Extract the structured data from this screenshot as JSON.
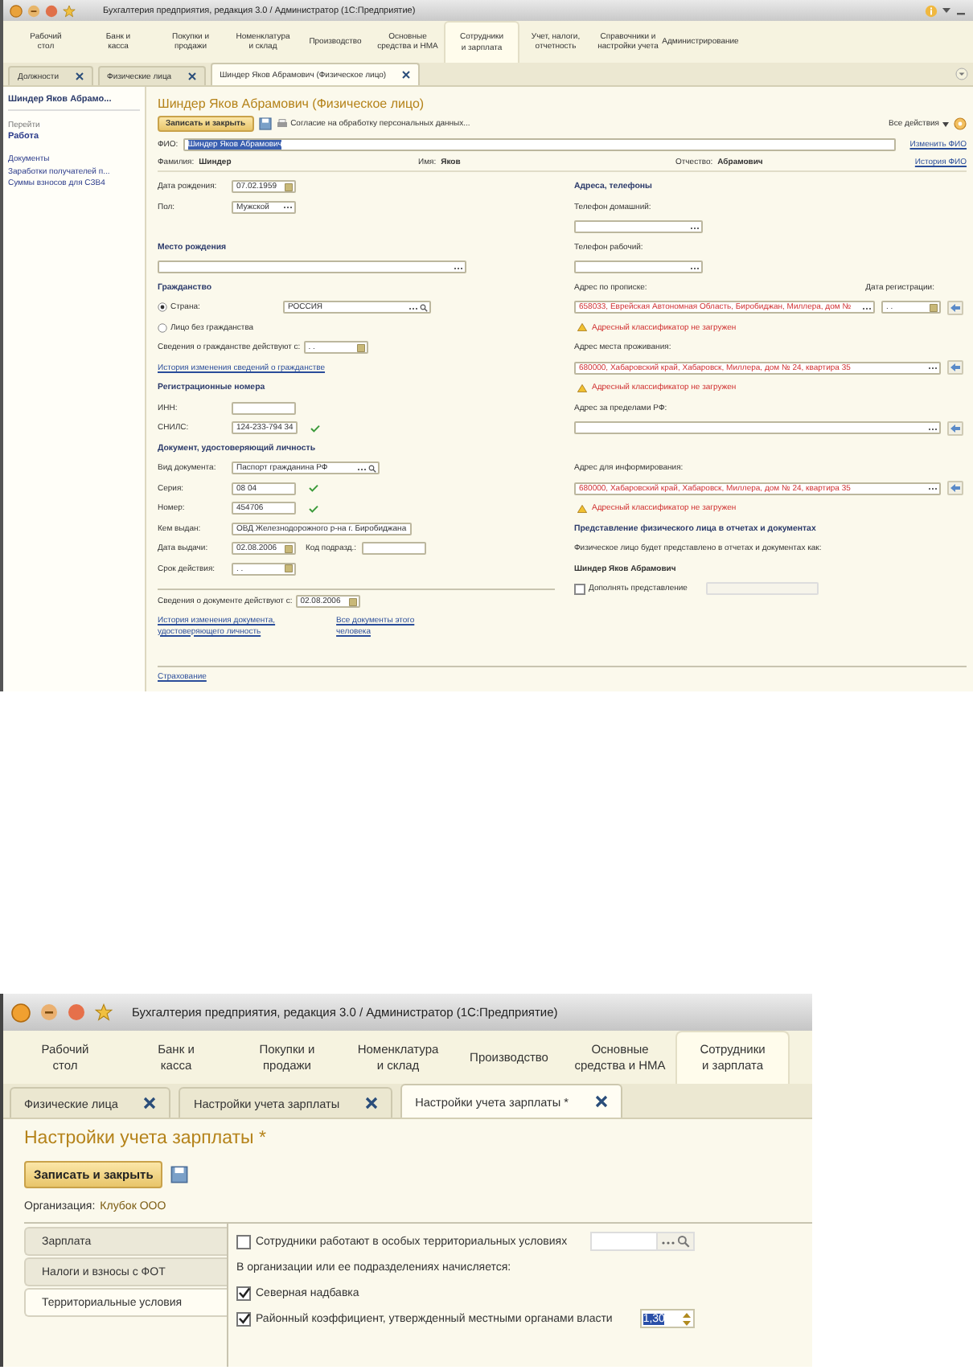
{
  "person_window": {
    "title": "Бухгалтерия предприятия, редакция 3.0 / Администратор (1С:Предприятие)",
    "sections": [
      {
        "label": "Рабочий\nстол",
        "selected": false
      },
      {
        "label": "Банк и\nкасса",
        "selected": false
      },
      {
        "label": "Покупки и\nпродажи",
        "selected": false
      },
      {
        "label": "Номенклатура\nи склад",
        "selected": false
      },
      {
        "label": "Производство",
        "selected": false
      },
      {
        "label": "Основные\nсредства и НМА",
        "selected": false
      },
      {
        "label": "Сотрудники\nи зарплата",
        "selected": true
      },
      {
        "label": "Учет, налоги,\nотчетность",
        "selected": false
      },
      {
        "label": "Справочники и\nнастройки учета",
        "selected": false
      },
      {
        "label": "Администрирование",
        "selected": false
      }
    ],
    "tabs": [
      {
        "label": "Должности",
        "selected": false
      },
      {
        "label": "Физические лица",
        "selected": false
      },
      {
        "label": "Шиндер Яков Абрамович (Физическое лицо)",
        "selected": true
      }
    ],
    "nav": {
      "title": "Шиндер Яков Абрамо...",
      "group": "Перейти",
      "items": [
        {
          "label": "Работа",
          "selected": true
        },
        {
          "label": "Документы",
          "selected": false
        },
        {
          "label": "Заработки получателей п...",
          "selected": false
        },
        {
          "label": "Суммы взносов для СЗВ4",
          "selected": false
        }
      ]
    },
    "heading": "Шиндер Яков Абрамович (Физическое лицо)",
    "toolbar": {
      "save": "Записать и закрыть",
      "consent": "Согласие на обработку персональных данных...",
      "all_actions": "Все действия"
    },
    "fio": {
      "label": "ФИО:",
      "value": "Шиндер Яков Абрамович",
      "link": "Изменить ФИО"
    },
    "name_parts": [
      {
        "label": "Фамилия:",
        "value": "Шиндер"
      },
      {
        "label": "Имя:",
        "value": "Яков"
      },
      {
        "label": "Отчество:",
        "value": "Абрамович"
      }
    ],
    "name_history_link": "История ФИО",
    "left": [
      {
        "kind": "field",
        "label": "Дата рождения:",
        "value": "07.02.1959",
        "control": {
          "kind": "date"
        }
      },
      {
        "kind": "field",
        "label": "Пол:",
        "value": "Мужской",
        "control": {
          "kind": "select"
        }
      },
      {
        "kind": "heading",
        "text": "Место рождения"
      },
      {
        "kind": "field",
        "control": {
          "kind": "wide"
        }
      },
      {
        "kind": "heading",
        "text": "Гражданство"
      },
      {
        "kind": "radio",
        "label": "Страна:",
        "selected": true,
        "value": "РОССИЯ"
      },
      {
        "kind": "radio",
        "label": "Лицо без гражданства",
        "selected": false
      },
      {
        "kind": "field",
        "label": "Сведения о гражданстве действуют с:",
        "value": ". .",
        "control": {
          "kind": "date"
        }
      },
      {
        "kind": "link",
        "text": "История изменения сведений о гражданстве"
      },
      {
        "kind": "heading",
        "text": "Регистрационные номера"
      },
      {
        "kind": "field",
        "label": "ИНН:",
        "control": {
          "kind": "text"
        }
      },
      {
        "kind": "field",
        "label": "СНИЛС:",
        "value": "124-233-794 34",
        "control": {
          "kind": "text"
        },
        "valid": true
      },
      {
        "kind": "heading",
        "text": "Документ, удостоверяющий личность"
      },
      {
        "kind": "field",
        "label": "Вид документа:",
        "value": "Паспорт гражданина РФ",
        "control": {
          "kind": "search"
        }
      },
      {
        "kind": "field",
        "label": "Серия:",
        "value": "08 04",
        "control": {
          "kind": "text"
        },
        "valid": true
      },
      {
        "kind": "field",
        "label": "Номер:",
        "value": "454706",
        "control": {
          "kind": "text"
        },
        "valid": true
      },
      {
        "kind": "field",
        "label": "Кем выдан:",
        "value": "ОВД Железнодорожного р-на г. Биробиджана",
        "control": {
          "kind": "text"
        }
      },
      {
        "kind": "field",
        "label": "Дата выдачи:",
        "value": "02.08.2006",
        "control": {
          "kind": "date"
        },
        "extra_label": "Код подразд.:"
      },
      {
        "kind": "field",
        "label": "Срок действия:",
        "value": ". .",
        "control": {
          "kind": "date"
        }
      }
    ],
    "document_valid": {
      "label": "Сведения о документе действуют с:",
      "value": "02.08.2006"
    },
    "document_links": [
      "История изменения документа,\nудостоверяющего личность",
      "Все документы этого\nчеловека"
    ],
    "footer_link": "Страхование",
    "right": [
      {
        "kind": "heading",
        "text": "Адреса, телефоны"
      },
      {
        "kind": "phone",
        "label": "Телефон домашний:"
      },
      {
        "kind": "phone",
        "label": "Телефон рабочий:"
      },
      {
        "kind": "address",
        "label": "Адрес по прописке:",
        "value": "658033, Еврейская Автономная Область, Биробиджан, Миллера, дом №",
        "warning": "Адресный классификатор не загружен",
        "reg_label": "Дата регистрации:",
        "reg_value": ". ."
      },
      {
        "kind": "address",
        "label": "Адрес места проживания:",
        "value": "680000, Хабаровский край, Хабаровск, Миллера, дом № 24, квартира 35",
        "warning": "Адресный классификатор не загружен"
      },
      {
        "kind": "address",
        "label": "Адрес за пределами РФ:"
      },
      {
        "kind": "address",
        "label": "Адрес для информирования:",
        "value": "680000, Хабаровский край, Хабаровск, Миллера, дом № 24, квартира 35",
        "warning": "Адресный классификатор не загружен"
      }
    ],
    "representation": {
      "heading": "Представление физического лица в отчетах и документах",
      "note": "Физическое лицо будет представлено в отчетах и документах как:",
      "name": "Шиндер Яков Абрамович",
      "option": {
        "label": "Дополнять представление",
        "checked": false
      }
    }
  },
  "salary_window": {
    "title": "Бухгалтерия предприятия, редакция 3.0 / Администратор  (1С:Предприятие)",
    "sections": [
      {
        "label": "Рабочий\nстол",
        "selected": false
      },
      {
        "label": "Банк и\nкасса",
        "selected": false
      },
      {
        "label": "Покупки и\nпродажи",
        "selected": false
      },
      {
        "label": "Номенклатура\nи склад",
        "selected": false
      },
      {
        "label": "Производство",
        "selected": false
      },
      {
        "label": "Основные\nсредства и НМА",
        "selected": false
      },
      {
        "label": "Сотрудники\nи зарплата",
        "selected": true
      }
    ],
    "tabs": [
      {
        "label": "Физические лица",
        "selected": false
      },
      {
        "label": "Настройки учета зарплаты",
        "selected": false
      },
      {
        "label": "Настройки учета зарплаты *",
        "selected": true
      }
    ],
    "heading": "Настройки учета зарплаты *",
    "save": "Записать и закрыть",
    "org_label": "Организация:",
    "org_value": "Клубок ООО",
    "side_tabs": [
      {
        "label": "Зарплата",
        "selected": false
      },
      {
        "label": "Налоги и взносы с ФОТ",
        "selected": false
      },
      {
        "label": "Территориальные условия",
        "selected": true
      }
    ],
    "options": [
      {
        "kind": "checkbox",
        "label": "Сотрудники работают в особых территориальных условиях",
        "checked": false,
        "control": {
          "kind": "search"
        }
      },
      {
        "kind": "text",
        "label": "В организации или ее подразделениях начисляется:"
      },
      {
        "kind": "checkbox",
        "label": "Северная надбавка",
        "checked": true
      },
      {
        "kind": "checkbox",
        "label": "Районный коэффициент, утвержденный местными органами власти",
        "checked": true,
        "control": {
          "kind": "spin",
          "value": "1,30"
        }
      }
    ]
  }
}
